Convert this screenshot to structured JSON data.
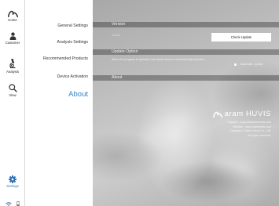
{
  "nav": {
    "home": "Home",
    "customer": "Customer",
    "analysis": "Analysis",
    "view": "View",
    "settings": "Settings"
  },
  "menu": {
    "items": [
      "General Settings",
      "Analysis Settings",
      "Recommended Products",
      "Device Activation",
      "About"
    ],
    "active": "About"
  },
  "version": {
    "title": "Version",
    "number": "1.1.0.1",
    "check_button": "Check Update"
  },
  "update_option": {
    "title": "Update Option",
    "description": "When the program is operated, the latest version is automatically checked.",
    "auto_update_label": "Automatic Update",
    "auto_update_checked": false
  },
  "about": {
    "title": "About",
    "brand": "aram HUVIS",
    "support": "Support : support@aramhuvis.com",
    "website": "Website : www.aramhuvis.com",
    "copyright": "Copyright © Aram Huvis Co., Ltd.",
    "rights": "All rights reserved."
  },
  "colors": {
    "accent": "#2f7fc2",
    "nav_icon": "#333333",
    "section_bar": "rgba(0,0,0,0.30)"
  },
  "icons": [
    "logo-icon",
    "user-icon",
    "microscope-icon",
    "search-icon",
    "gear-icon",
    "wifi-icon",
    "battery-icon"
  ]
}
